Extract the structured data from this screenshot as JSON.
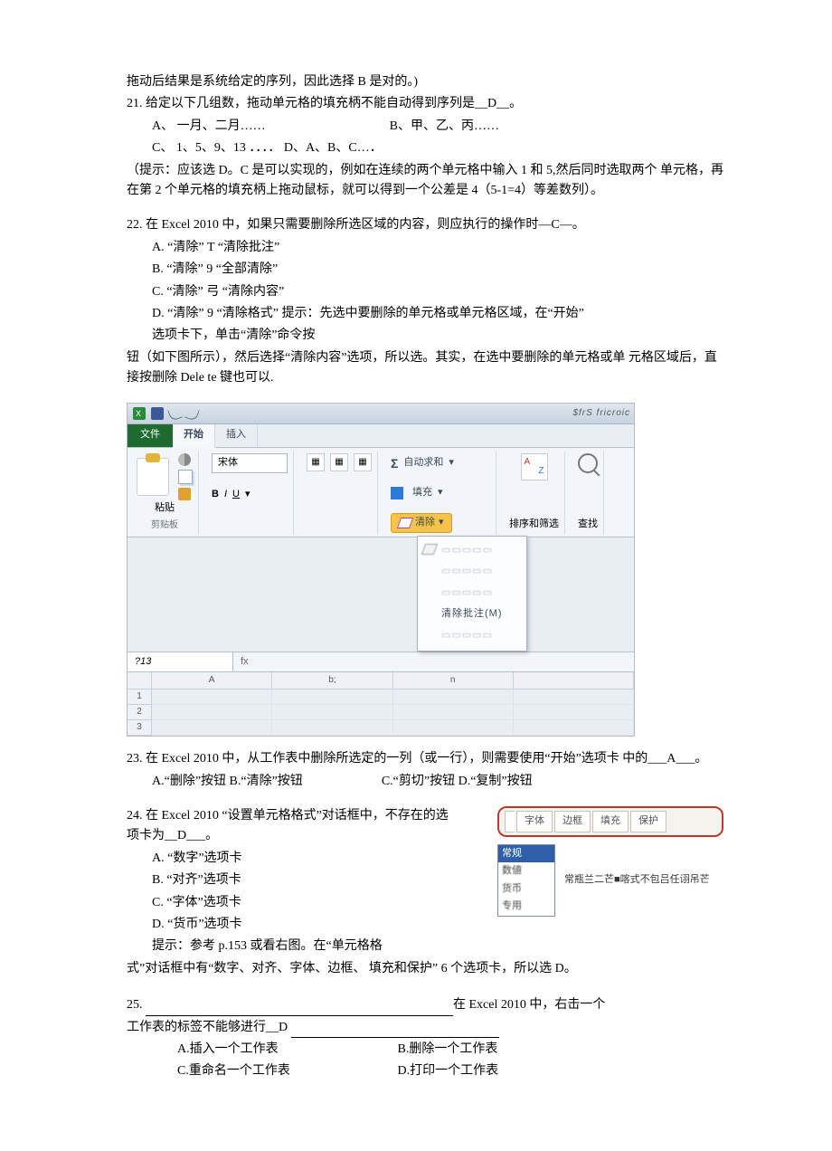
{
  "intro": "拖动后结果是系统给定的序列，因此选择 B 是对的。)",
  "q21": {
    "stem": "21. 给定以下几组数，拖动单元格的填充柄不能自动得到序列是__D__。",
    "a": "A、 一月、二月……",
    "b": "B、甲、乙、丙……",
    "c": "C、 1、5、9、13 ．．．． D、A、B、C…．",
    "hint": "（提示：应该选 D。C 是可以实现的，例如在连续的两个单元格中输入 1 和 5,然后同时选取两个 单元格，再在第 2 个单元格的填充柄上拖动鼠标，就可以得到一个公差是 4（5-1=4）等差数列）。"
  },
  "q22": {
    "stem": "22. 在 Excel 2010 中，如果只需要删除所选区域的内容，则应执行的操作时—C—。",
    "a": "A. “清除” T “清除批注”",
    "b": "B. “清除” 9 “全部清除”",
    "c": "C. “清除” 弓 “清除内容”",
    "d": "D. “清除” 9 “清除格式” 提示：先选中要删除的单元格或单元格区域，在“开始”",
    "d2": "选项卡下，单击“清除”命令按",
    "tail": "钮（如下图所示），然后选择“清除内容”选项，所以选。其实，在选中要删除的单元格或单 元格区域后，直接按删除 Dele te 键也可以."
  },
  "excel": {
    "corner": "$frS fricroic",
    "tab_file": "文件",
    "tab_home": "开始",
    "tab_insert": "插入",
    "font_name": "宋体",
    "paste": "粘贴",
    "grp_clip": "剪贴板",
    "sum": "自动求和",
    "fill": "填充",
    "clear": "清除",
    "sort": "排序和筛选",
    "find": "查找",
    "namebox": "?13",
    "cols": [
      "A",
      "b;",
      "n"
    ],
    "menu_clear_comment": "清除批注(M)"
  },
  "q23": {
    "stem": "23. 在 Excel 2010 中，从工作表中删除所选定的一列（或一行），则需要使用“开始”选项卡 中的___A___。",
    "a": "A.“删除”按钮 B.“清除”按钮",
    "c": "C.“剪切”按钮 D.“复制”按钮"
  },
  "q24": {
    "stem": "24. 在 Excel 2010 “设置单元格格式”对话框中，不存在的选项卡为__D___。",
    "a": "A. “数字”选项卡",
    "b": "B. “对齐”选项卡",
    "c": "C. “字体”选项卡",
    "d": "D. “货币”选项卡",
    "hint1": "提示：参考 p.153 或看右图。在“单元格格",
    "hint2": "式”对话框中有“数字、对齐、字体、边框、 填充和保护” 6 个选项卡，所以选 D。",
    "tabs": {
      "t1": "字体",
      "t2": "边框",
      "t3": "填充",
      "t4": "保护"
    },
    "list_sel": "常规",
    "list_suffix": "专用",
    "caption": "常瓶兰二芒■喀式不包吕任诩吊芒"
  },
  "q25": {
    "line1_tail": "在 Excel 2010 中，右击一个",
    "line2": "工作表的标签不能够进行__D",
    "a": "A.插入一个工作表",
    "b": "B.删除一个工作表",
    "c": "C.重命名一个工作表",
    "d": "D.打印一个工作表"
  }
}
